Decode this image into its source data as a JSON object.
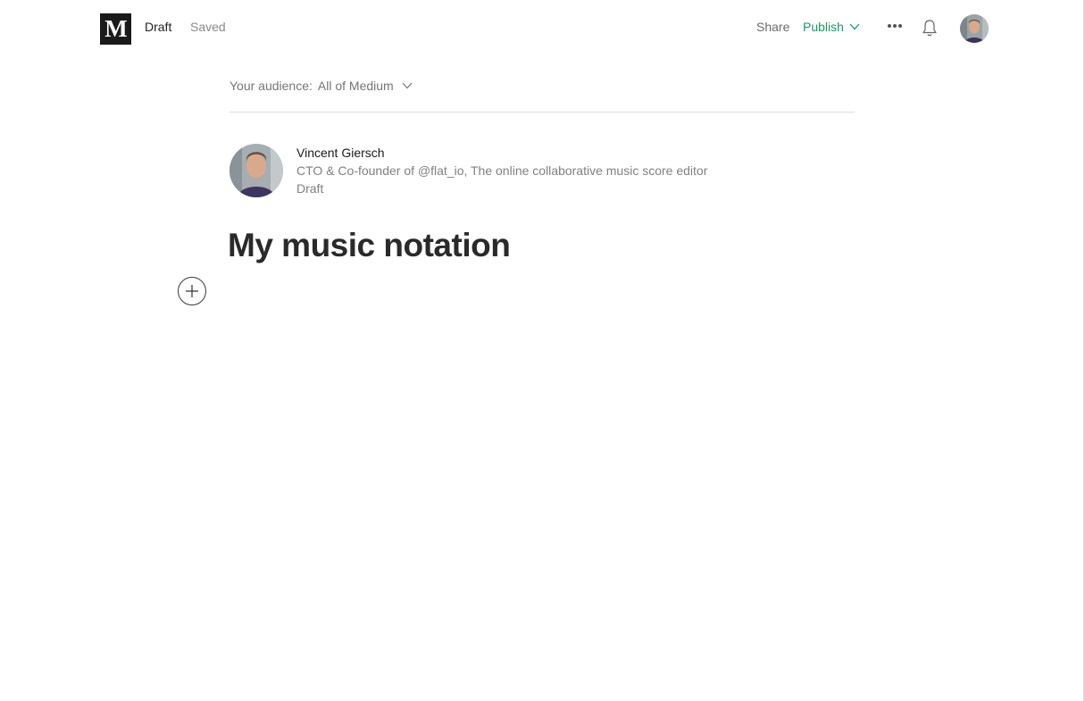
{
  "topbar": {
    "logo": "M",
    "status": "Draft",
    "save_state": "Saved",
    "share": "Share",
    "publish": "Publish"
  },
  "icons": {
    "publish_chevron": "chevron-down-icon",
    "more": "more-dots-icon",
    "notifications": "bell-icon",
    "add": "plus-circle-icon"
  },
  "audience": {
    "label": "Your audience:",
    "value": "All of Medium"
  },
  "author": {
    "name": "Vincent Giersch",
    "bio": "CTO & Co-founder of @flat_io, The online collaborative music score editor",
    "state": "Draft"
  },
  "post": {
    "title": "My music notation"
  },
  "colors": {
    "accent": "#1c9963",
    "logo_bg": "#1a1a1a"
  }
}
